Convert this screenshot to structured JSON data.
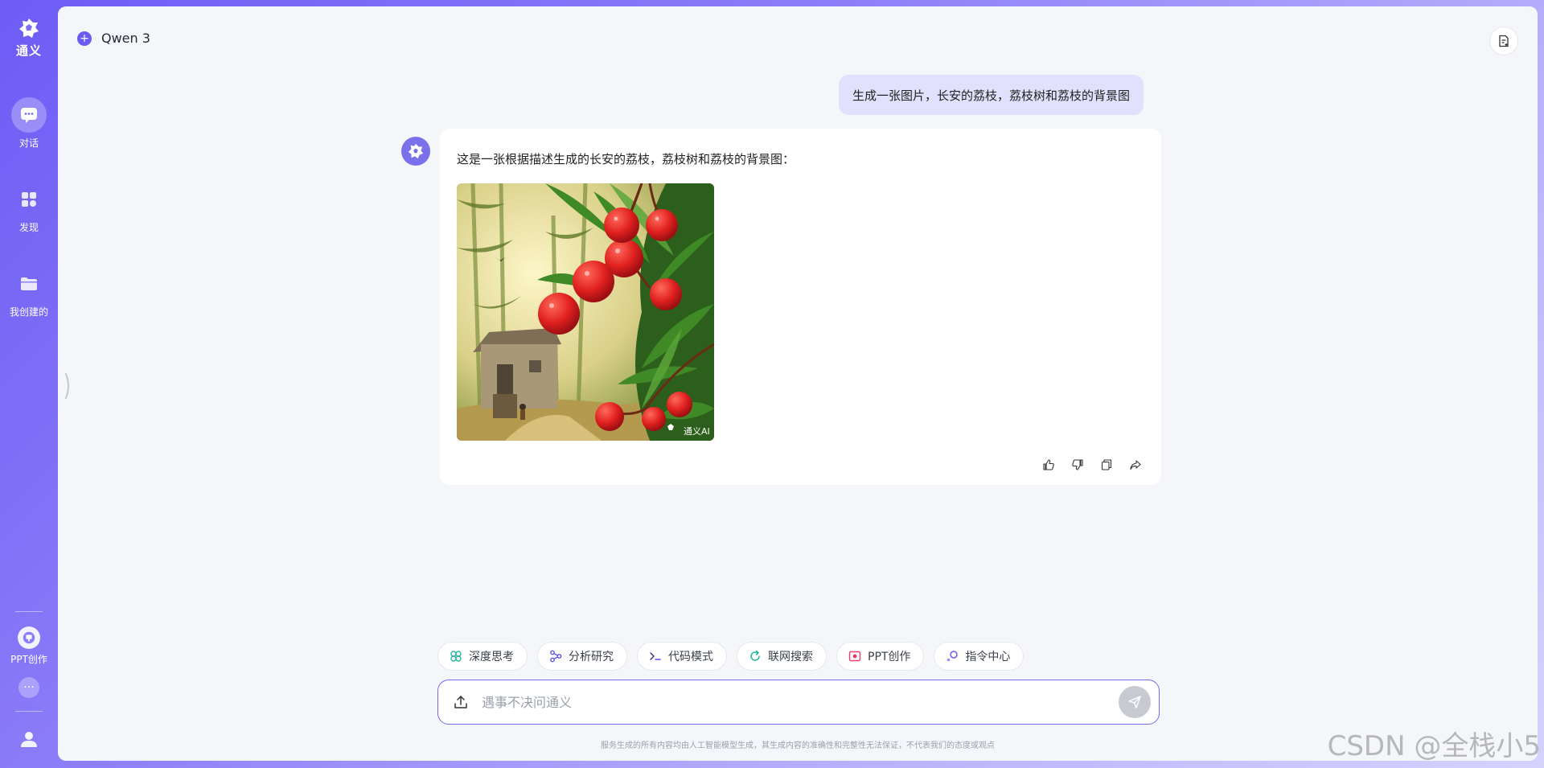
{
  "sidebar": {
    "brand": "通义",
    "nav": [
      {
        "label": "对话",
        "icon": "chat-icon",
        "active": true
      },
      {
        "label": "发现",
        "icon": "grid-icon",
        "active": false
      },
      {
        "label": "我创建的",
        "icon": "folder-icon",
        "active": false
      }
    ],
    "ppt_label": "PPT创作",
    "more_label": "···"
  },
  "header": {
    "model_name": "Qwen 3"
  },
  "conversation": {
    "user_message": "生成一张图片，长安的荔枝，荔枝树和荔枝的背景图",
    "bot_message": "这是一张根据描述生成的长安的荔枝，荔枝树和荔枝的背景图：",
    "image_watermark": "通义AI"
  },
  "toolbar": {
    "chips": [
      {
        "label": "深度思考",
        "icon": "deep-think-icon",
        "color": "#2bb6a3"
      },
      {
        "label": "分析研究",
        "icon": "analysis-icon",
        "color": "#5a4ff0"
      },
      {
        "label": "代码模式",
        "icon": "code-icon",
        "color": "#3b3f8c"
      },
      {
        "label": "联网搜索",
        "icon": "web-search-icon",
        "color": "#23b59b"
      },
      {
        "label": "PPT创作",
        "icon": "ppt-icon",
        "color": "#ea3f6c"
      },
      {
        "label": "指令中心",
        "icon": "command-icon",
        "color": "#6a5cf2"
      }
    ]
  },
  "input": {
    "placeholder": "遇事不决问通义"
  },
  "footer": {
    "disclaimer": "服务生成的所有内容均由人工智能模型生成，其生成内容的准确性和完整性无法保证，不代表我们的态度或观点"
  },
  "watermark": "CSDN @全栈小5",
  "colors": {
    "accent": "#6a5cf2",
    "user_bubble": "#e2e1fd",
    "main_bg": "#f5f6fa"
  }
}
